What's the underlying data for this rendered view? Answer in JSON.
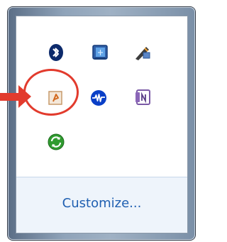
{
  "tray_popup": {
    "icons": [
      {
        "name": "bluetooth-icon"
      },
      {
        "name": "network-icon"
      },
      {
        "name": "pen-tool-icon"
      },
      {
        "name": "highlighted-app-icon"
      },
      {
        "name": "audio-waveform-icon"
      },
      {
        "name": "onenote-icon"
      },
      {
        "name": "sync-icon"
      }
    ],
    "customize_label": "Customize..."
  },
  "colors": {
    "accent_red": "#e23b2d",
    "link_blue": "#1f5fb1",
    "frame": "#8fa3b9"
  }
}
